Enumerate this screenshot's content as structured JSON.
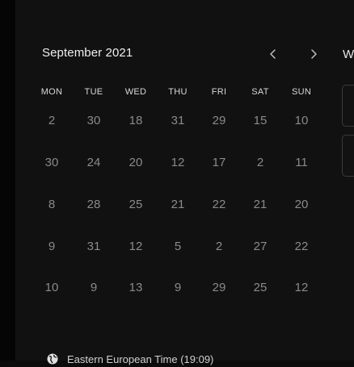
{
  "calendar": {
    "month_label": "September 2021",
    "weekdays": [
      "MON",
      "TUE",
      "WED",
      "THU",
      "FRI",
      "SAT",
      "SUN"
    ],
    "weeks": [
      [
        "2",
        "30",
        "18",
        "31",
        "29",
        "15",
        "10"
      ],
      [
        "30",
        "24",
        "20",
        "12",
        "17",
        "2",
        "11"
      ],
      [
        "8",
        "28",
        "25",
        "21",
        "22",
        "21",
        "20"
      ],
      [
        "9",
        "31",
        "12",
        "5",
        "2",
        "27",
        "22"
      ],
      [
        "10",
        "9",
        "13",
        "9",
        "29",
        "25",
        "12"
      ]
    ],
    "prev_icon": "chevron-left",
    "next_icon": "chevron-right"
  },
  "side_panel": {
    "label": "W"
  },
  "timezone": {
    "label": "Eastern European Time (19:09)",
    "icon": "globe"
  },
  "colors": {
    "background": "#111111",
    "text": "#efefef",
    "muted_day": "#8a8a8a"
  }
}
